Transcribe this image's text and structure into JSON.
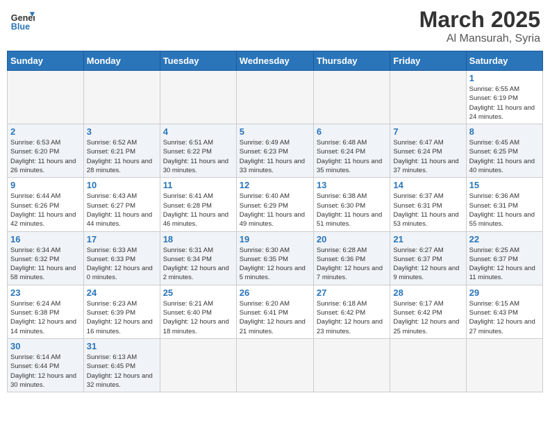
{
  "header": {
    "logo_general": "General",
    "logo_blue": "Blue",
    "month": "March 2025",
    "location": "Al Mansurah, Syria"
  },
  "weekdays": [
    "Sunday",
    "Monday",
    "Tuesday",
    "Wednesday",
    "Thursday",
    "Friday",
    "Saturday"
  ],
  "weeks": [
    [
      {
        "day": "",
        "info": ""
      },
      {
        "day": "",
        "info": ""
      },
      {
        "day": "",
        "info": ""
      },
      {
        "day": "",
        "info": ""
      },
      {
        "day": "",
        "info": ""
      },
      {
        "day": "",
        "info": ""
      },
      {
        "day": "1",
        "info": "Sunrise: 6:55 AM\nSunset: 6:19 PM\nDaylight: 11 hours\nand 24 minutes."
      }
    ],
    [
      {
        "day": "2",
        "info": "Sunrise: 6:53 AM\nSunset: 6:20 PM\nDaylight: 11 hours\nand 26 minutes."
      },
      {
        "day": "3",
        "info": "Sunrise: 6:52 AM\nSunset: 6:21 PM\nDaylight: 11 hours\nand 28 minutes."
      },
      {
        "day": "4",
        "info": "Sunrise: 6:51 AM\nSunset: 6:22 PM\nDaylight: 11 hours\nand 30 minutes."
      },
      {
        "day": "5",
        "info": "Sunrise: 6:49 AM\nSunset: 6:23 PM\nDaylight: 11 hours\nand 33 minutes."
      },
      {
        "day": "6",
        "info": "Sunrise: 6:48 AM\nSunset: 6:24 PM\nDaylight: 11 hours\nand 35 minutes."
      },
      {
        "day": "7",
        "info": "Sunrise: 6:47 AM\nSunset: 6:24 PM\nDaylight: 11 hours\nand 37 minutes."
      },
      {
        "day": "8",
        "info": "Sunrise: 6:45 AM\nSunset: 6:25 PM\nDaylight: 11 hours\nand 40 minutes."
      }
    ],
    [
      {
        "day": "9",
        "info": "Sunrise: 6:44 AM\nSunset: 6:26 PM\nDaylight: 11 hours\nand 42 minutes."
      },
      {
        "day": "10",
        "info": "Sunrise: 6:43 AM\nSunset: 6:27 PM\nDaylight: 11 hours\nand 44 minutes."
      },
      {
        "day": "11",
        "info": "Sunrise: 6:41 AM\nSunset: 6:28 PM\nDaylight: 11 hours\nand 46 minutes."
      },
      {
        "day": "12",
        "info": "Sunrise: 6:40 AM\nSunset: 6:29 PM\nDaylight: 11 hours\nand 49 minutes."
      },
      {
        "day": "13",
        "info": "Sunrise: 6:38 AM\nSunset: 6:30 PM\nDaylight: 11 hours\nand 51 minutes."
      },
      {
        "day": "14",
        "info": "Sunrise: 6:37 AM\nSunset: 6:31 PM\nDaylight: 11 hours\nand 53 minutes."
      },
      {
        "day": "15",
        "info": "Sunrise: 6:36 AM\nSunset: 6:31 PM\nDaylight: 11 hours\nand 55 minutes."
      }
    ],
    [
      {
        "day": "16",
        "info": "Sunrise: 6:34 AM\nSunset: 6:32 PM\nDaylight: 11 hours\nand 58 minutes."
      },
      {
        "day": "17",
        "info": "Sunrise: 6:33 AM\nSunset: 6:33 PM\nDaylight: 12 hours\nand 0 minutes."
      },
      {
        "day": "18",
        "info": "Sunrise: 6:31 AM\nSunset: 6:34 PM\nDaylight: 12 hours\nand 2 minutes."
      },
      {
        "day": "19",
        "info": "Sunrise: 6:30 AM\nSunset: 6:35 PM\nDaylight: 12 hours\nand 5 minutes."
      },
      {
        "day": "20",
        "info": "Sunrise: 6:28 AM\nSunset: 6:36 PM\nDaylight: 12 hours\nand 7 minutes."
      },
      {
        "day": "21",
        "info": "Sunrise: 6:27 AM\nSunset: 6:37 PM\nDaylight: 12 hours\nand 9 minutes."
      },
      {
        "day": "22",
        "info": "Sunrise: 6:25 AM\nSunset: 6:37 PM\nDaylight: 12 hours\nand 11 minutes."
      }
    ],
    [
      {
        "day": "23",
        "info": "Sunrise: 6:24 AM\nSunset: 6:38 PM\nDaylight: 12 hours\nand 14 minutes."
      },
      {
        "day": "24",
        "info": "Sunrise: 6:23 AM\nSunset: 6:39 PM\nDaylight: 12 hours\nand 16 minutes."
      },
      {
        "day": "25",
        "info": "Sunrise: 6:21 AM\nSunset: 6:40 PM\nDaylight: 12 hours\nand 18 minutes."
      },
      {
        "day": "26",
        "info": "Sunrise: 6:20 AM\nSunset: 6:41 PM\nDaylight: 12 hours\nand 21 minutes."
      },
      {
        "day": "27",
        "info": "Sunrise: 6:18 AM\nSunset: 6:42 PM\nDaylight: 12 hours\nand 23 minutes."
      },
      {
        "day": "28",
        "info": "Sunrise: 6:17 AM\nSunset: 6:42 PM\nDaylight: 12 hours\nand 25 minutes."
      },
      {
        "day": "29",
        "info": "Sunrise: 6:15 AM\nSunset: 6:43 PM\nDaylight: 12 hours\nand 27 minutes."
      }
    ],
    [
      {
        "day": "30",
        "info": "Sunrise: 6:14 AM\nSunset: 6:44 PM\nDaylight: 12 hours\nand 30 minutes."
      },
      {
        "day": "31",
        "info": "Sunrise: 6:13 AM\nSunset: 6:45 PM\nDaylight: 12 hours\nand 32 minutes."
      },
      {
        "day": "",
        "info": ""
      },
      {
        "day": "",
        "info": ""
      },
      {
        "day": "",
        "info": ""
      },
      {
        "day": "",
        "info": ""
      },
      {
        "day": "",
        "info": ""
      }
    ]
  ]
}
